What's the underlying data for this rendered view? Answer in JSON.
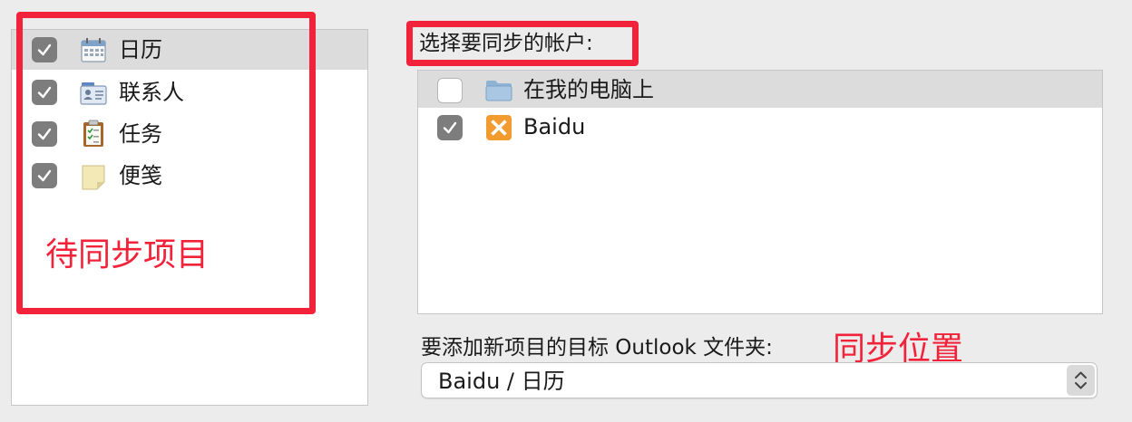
{
  "sync_items": [
    {
      "label": "日历",
      "checked": true,
      "icon": "calendar-icon"
    },
    {
      "label": "联系人",
      "checked": true,
      "icon": "contacts-icon"
    },
    {
      "label": "任务",
      "checked": true,
      "icon": "tasks-icon"
    },
    {
      "label": "便笺",
      "checked": true,
      "icon": "notes-icon"
    }
  ],
  "annotation_left": "待同步项目",
  "accounts_heading": "选择要同步的帐户:",
  "accounts": [
    {
      "label": "在我的电脑上",
      "checked": false,
      "icon": "folder-icon"
    },
    {
      "label": "Baidu",
      "checked": true,
      "icon": "exchange-icon"
    }
  ],
  "target_folder_label": "要添加新项目的目标 Outlook 文件夹:",
  "annotation_right": "同步位置",
  "target_folder_value": "Baidu / 日历",
  "colors": {
    "annotation_red": "#f2223a",
    "checkbox_checked": "#7d7d7d",
    "selection": "#dcdcdc"
  }
}
